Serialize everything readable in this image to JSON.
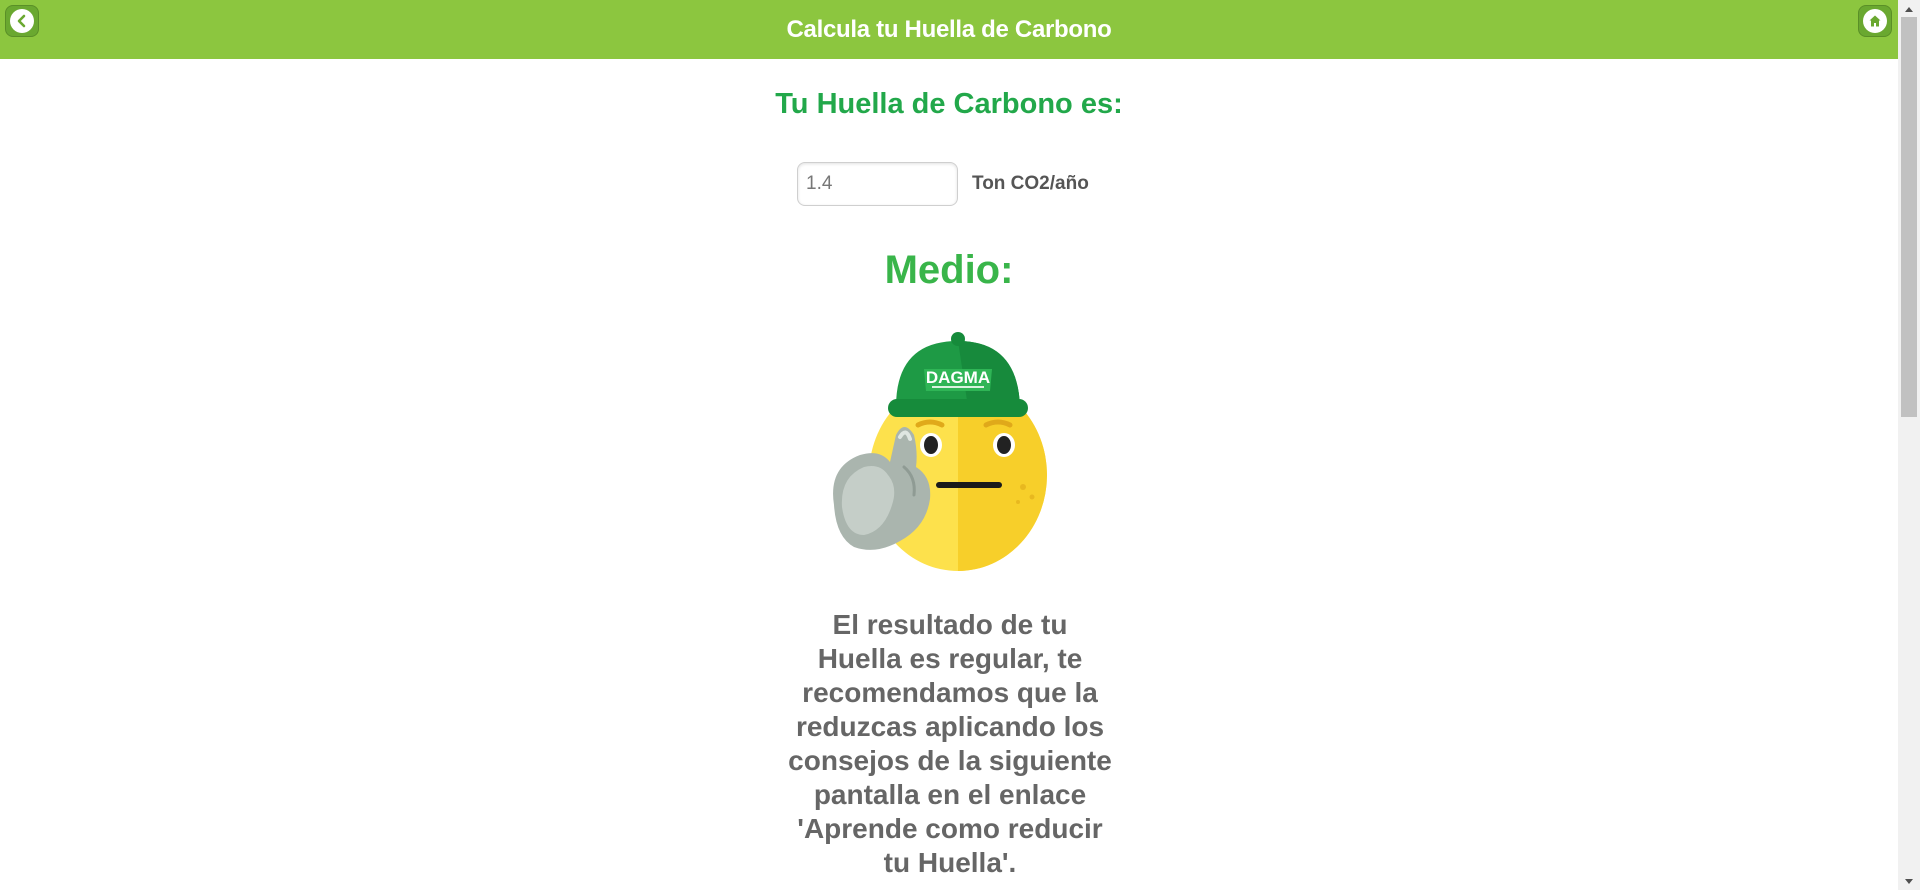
{
  "header": {
    "title": "Calcula tu Huella de Carbono",
    "back_icon": "chevron-left-icon",
    "home_icon": "home-icon"
  },
  "result": {
    "heading": "Tu Huella de Carbono es:",
    "value": "1.4",
    "unit": "Ton CO2/año",
    "level": "Medio:",
    "mascot_cap_text": "DAGMA",
    "message": "El resultado de tu Huella es regular, te recomendamos que la reduzcas aplicando los consejos de la siguiente pantalla en el enlace 'Aprende como reducir tu Huella'."
  },
  "colors": {
    "header_bg": "#8cc63f",
    "heading_green": "#22a84a",
    "level_green": "#39b54a",
    "message_gray": "#666666"
  }
}
